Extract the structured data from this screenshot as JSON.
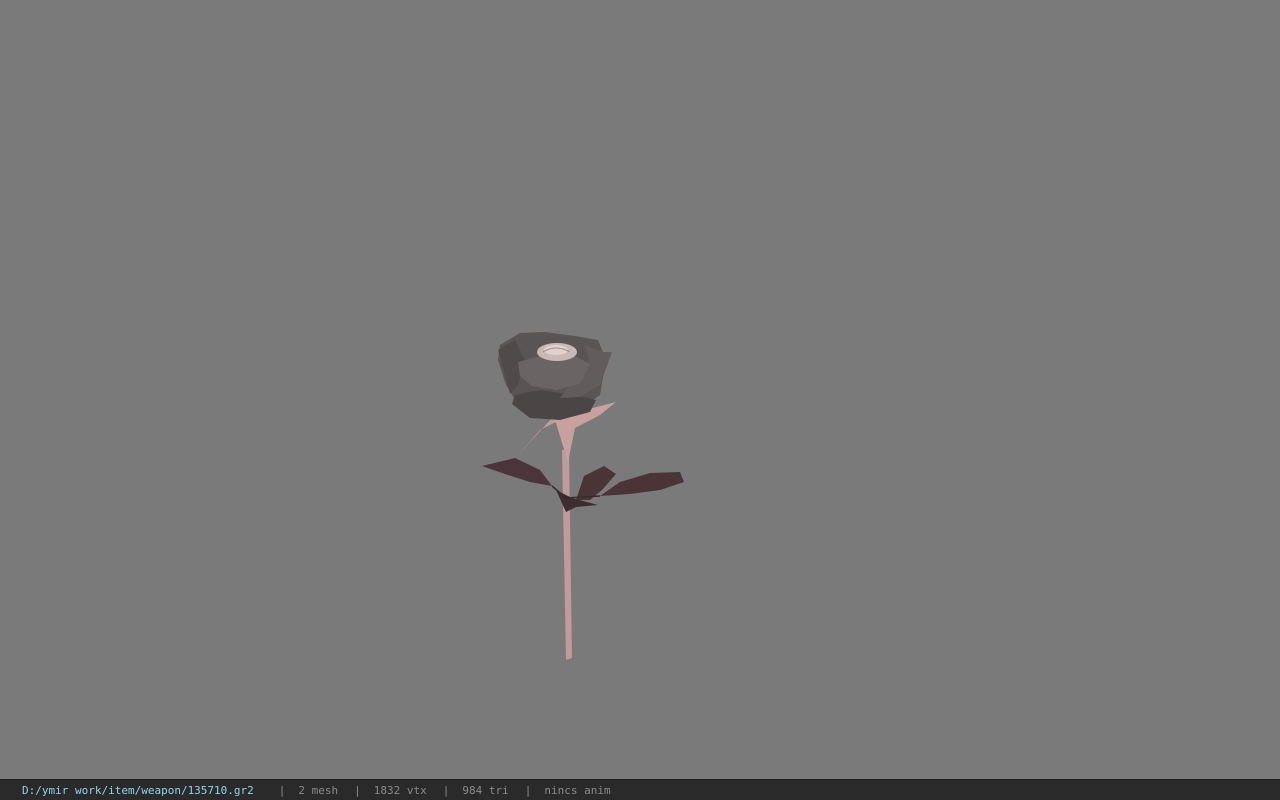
{
  "statusbar": {
    "file_path": "D:/ymir work/item/weapon/135710.gr2",
    "separator": "|",
    "mesh_count": "2 mesh",
    "vertex_count": "1832 vtx",
    "triangle_count": "984 tri",
    "animation_status": "nincs anim"
  },
  "colors": {
    "viewport_background": "#7a7a7a",
    "statusbar_background": "#2a2a2a",
    "path_text": "#8fd3ea",
    "info_text": "#8a8a8a",
    "stem": "#c39a9a",
    "leaf": "#4a3438",
    "petal": "#555050"
  },
  "model_preview": {
    "subject": "rose-model"
  }
}
